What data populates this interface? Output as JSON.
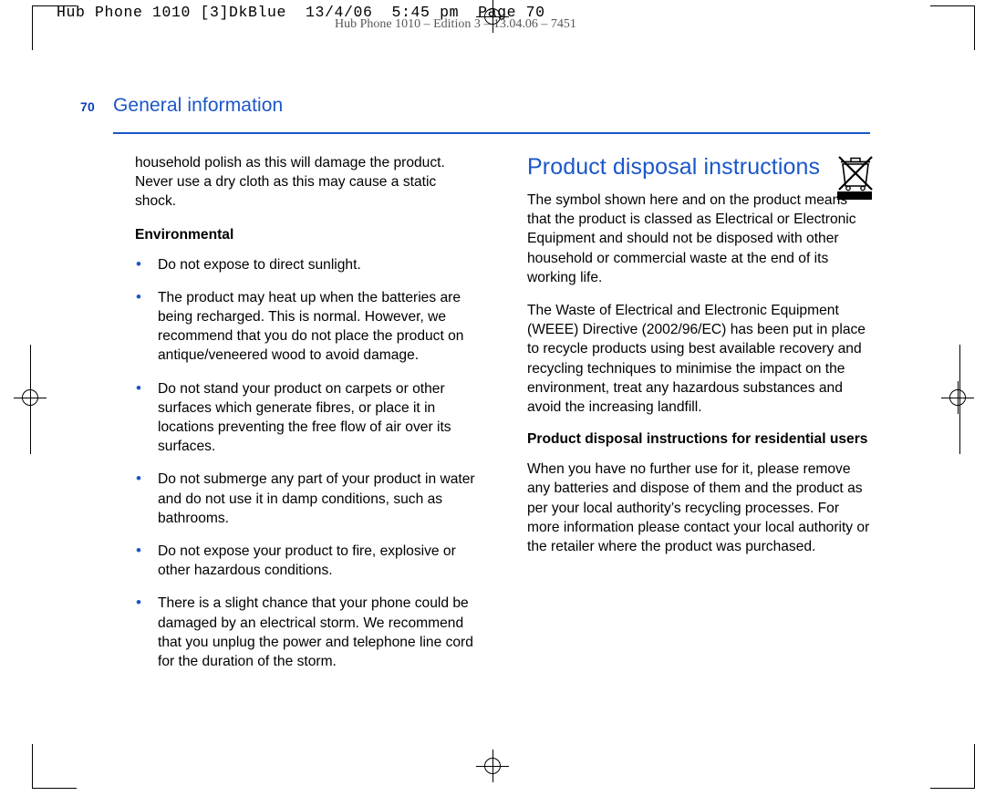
{
  "print_header": {
    "text": "Hub Phone 1010 [3]DkBlue  13/4/06  5:45 pm  Page 70"
  },
  "doc_slug": {
    "text": "Hub Phone 1010 – Edition 3 – 13.04.06 – 7451"
  },
  "page": {
    "number": "70",
    "section_title": "General information",
    "accent_color": "#1b57c8"
  },
  "left_column": {
    "continued_paragraph": "household polish as this will damage the product. Never use a dry cloth as this may cause a static shock.",
    "subheading": "Environmental",
    "bullets": [
      "Do not expose to direct sunlight.",
      "The product may heat up when the batteries are being recharged. This is normal. However, we recommend that you do not place the product on antique/veneered wood to avoid damage.",
      "Do not stand your product on carpets or other surfaces which generate fibres, or place it in locations preventing the free flow of air over its surfaces.",
      "Do not submerge any part of your product in water and do not use it in damp conditions, such as bathrooms.",
      "Do not expose your product to fire, explosive or other hazardous conditions.",
      "There is a slight chance that your phone could be damaged by an electrical storm. We recommend that you unplug the power and telephone line cord for the duration of the storm."
    ]
  },
  "right_column": {
    "heading": "Product disposal instructions",
    "symbol_name": "crossed-out-wheelie-bin-icon",
    "paragraph_1": "The symbol shown here and on the product means that the product is classed as Electrical or Electronic Equipment and should not be disposed with other household or commercial waste at the end of its working life.",
    "paragraph_2": "The Waste of Electrical and Electronic Equipment (WEEE) Directive (2002/96/EC) has been put in place to recycle products using best available recovery and recycling techniques to minimise the impact on the environment, treat any hazardous substances and avoid the increasing landfill.",
    "subheading": "Product disposal instructions for residential users",
    "paragraph_3": "When you have no further use for it, please remove any batteries and dispose of them and the product as per your local authority’s recycling processes. For more information please contact your local authority or the retailer where the product was purchased."
  }
}
